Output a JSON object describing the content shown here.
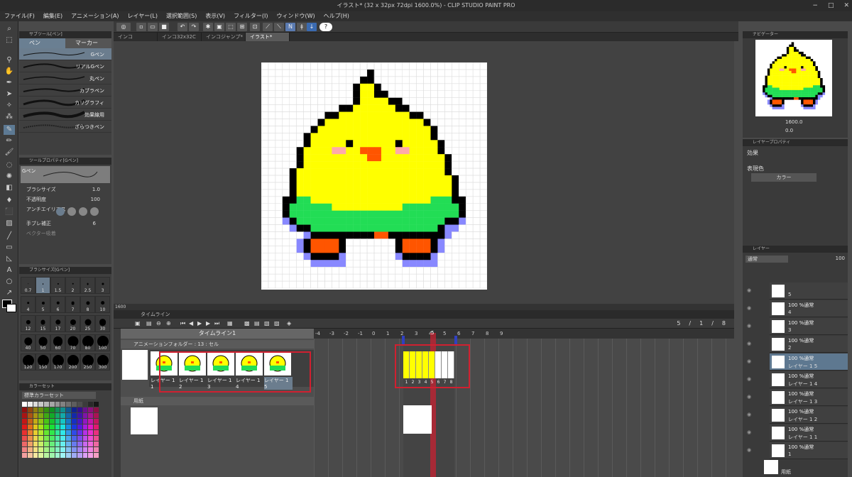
{
  "window": {
    "title": "イラスト* (32 x 32px 72dpi 1600.0%) - CLIP STUDIO PAINT PRO",
    "controls": [
      "−",
      "□",
      "✕"
    ]
  },
  "menu": [
    "ファイル(F)",
    "編集(E)",
    "アニメーション(A)",
    "レイヤー(L)",
    "選択範囲(S)",
    "表示(V)",
    "フィルター(I)",
    "ウィンドウ(W)",
    "ヘルプ(H)"
  ],
  "tabs": [
    "インコ",
    "インコ32x32C",
    "インコジャンプ*",
    "イラスト*"
  ],
  "active_tab_index": 3,
  "subtool": {
    "header": "サブツール[ペン]",
    "tabs": [
      "ペン",
      "マーカー"
    ],
    "brushes": [
      "Gペン",
      "リアルGペン",
      "丸ペン",
      "カブラペン",
      "カリグラフィ",
      "効果線用",
      "ざらつきペン"
    ],
    "selected": "Gペン"
  },
  "toolprop": {
    "header": "ツールプロパティ[Gペン]",
    "preview_label": "Gペン",
    "brush_size_label": "ブラシサイズ",
    "brush_size_value": "1.0",
    "opacity_label": "不透明度",
    "opacity_value": "100",
    "antialias_label": "アンチエイリアス",
    "stabilization_label": "手ブレ補正",
    "stabilization_value": "6",
    "vector_label": "ベクター吸着"
  },
  "brushsize": {
    "header": "ブラシサイズ[Gペン]",
    "sizes": [
      "0.7",
      "1",
      "1.5",
      "2",
      "2.5",
      "3",
      "4",
      "5",
      "6",
      "7",
      "8",
      "10",
      "12",
      "15",
      "17",
      "20",
      "25",
      "30",
      "40",
      "50",
      "60",
      "70",
      "80",
      "100",
      "120",
      "150",
      "170",
      "200",
      "250",
      "300"
    ],
    "selected": "1"
  },
  "colorset": {
    "header": "カラーセット",
    "set_name": "標準カラーセット"
  },
  "canvas": {
    "zoom": "1600"
  },
  "timeline": {
    "header": "タイムライン",
    "name": "タイムライン1",
    "frame_counter": [
      "5",
      "/",
      "1",
      "/",
      "8"
    ],
    "folder_label": "アニメーションフォルダー : 13 : セル",
    "paper_label": "用紙",
    "cels": [
      "レイヤー 1 1",
      "レイヤー 1 2",
      "レイヤー 1 3",
      "レイヤー 1 4",
      "レイヤー 1 5"
    ],
    "ruler": [
      "-4",
      "-3",
      "-2",
      "-1",
      "0",
      "1",
      "2",
      "3",
      "4",
      "5",
      "6",
      "7",
      "8",
      "9"
    ],
    "current_frame": "5",
    "frame_numbers": [
      "1",
      "2",
      "3",
      "4",
      "5",
      "6",
      "7",
      "8"
    ]
  },
  "navigator": {
    "header": "ナビゲーター",
    "zoom": "1600.0",
    "rotation": "0.0"
  },
  "layerprop": {
    "header": "レイヤープロパティ",
    "effect_label": "効果",
    "color_label": "表現色",
    "color_value": "カラー"
  },
  "layers": {
    "header": "レイヤー",
    "blend": "通常",
    "opacity": "100",
    "rows": [
      {
        "l1": "",
        "l2": "5"
      },
      {
        "l1": "100 %通常",
        "l2": "4"
      },
      {
        "l1": "100 %通常",
        "l2": "3"
      },
      {
        "l1": "100 %通常",
        "l2": "2"
      },
      {
        "l1": "100 %通常",
        "l2": "レイヤー 1 5"
      },
      {
        "l1": "100 %通常",
        "l2": "レイヤー 1 4"
      },
      {
        "l1": "100 %通常",
        "l2": "レイヤー 1 3"
      },
      {
        "l1": "100 %通常",
        "l2": "レイヤー 1 2"
      },
      {
        "l1": "100 %通常",
        "l2": "レイヤー 1 1"
      },
      {
        "l1": "100 %通常",
        "l2": "1"
      }
    ],
    "selected_index": 4,
    "paper_label": "用紙"
  },
  "colors": {
    "yellow": "#ffff00",
    "green": "#22dd55",
    "orange": "#ff5500",
    "pink": "#ffaaaa",
    "shadow": "#8888ff",
    "accent": "#d02030"
  }
}
